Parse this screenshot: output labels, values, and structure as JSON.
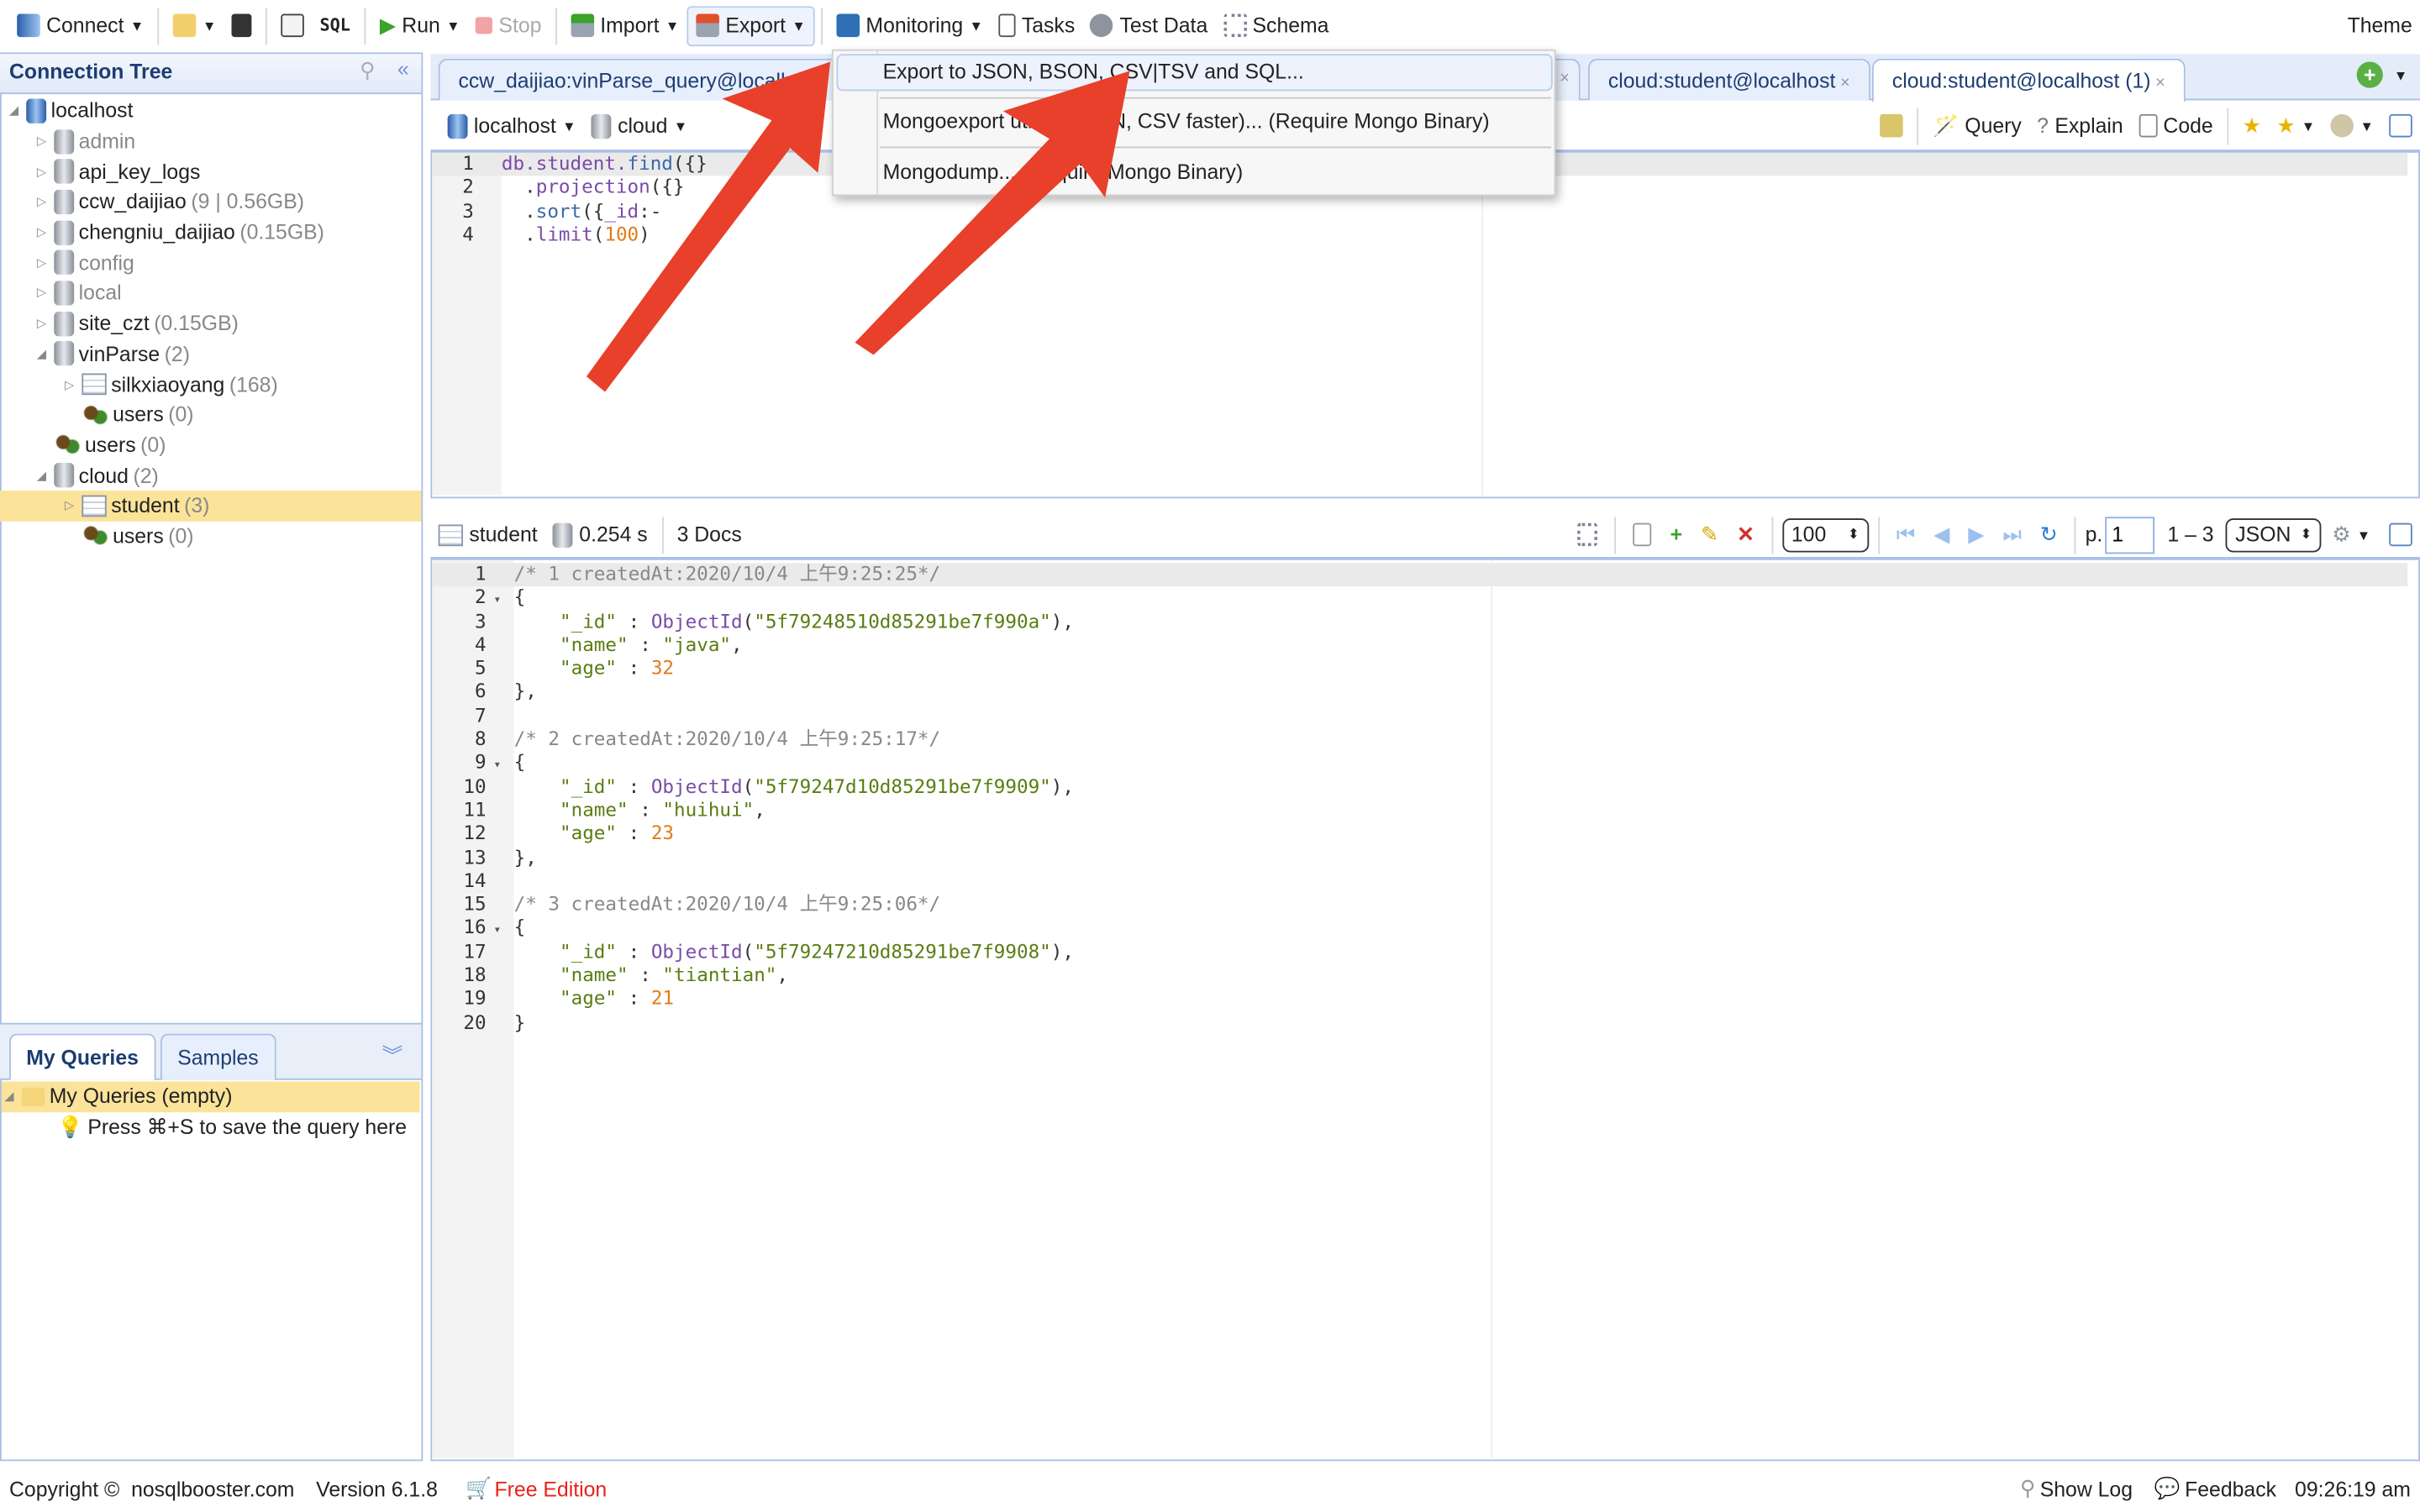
{
  "toolbar": {
    "connect": "Connect",
    "sql": "SQL",
    "run": "Run",
    "stop": "Stop",
    "import": "Import",
    "export": "Export",
    "monitoring": "Monitoring",
    "tasks": "Tasks",
    "test_data": "Test Data",
    "schema": "Schema",
    "theme": "Theme"
  },
  "export_menu": {
    "items": [
      "Export to JSON, BSON, CSV|TSV and SQL...",
      "Mongoexport utility (JSON, CSV faster)... (Require Mongo Binary)",
      "Mongodump... (Require Mongo Binary)"
    ]
  },
  "connection_tree": {
    "title": "Connection Tree",
    "items": [
      {
        "label": "localhost",
        "meta": "",
        "level": 0,
        "icon": "server",
        "twisty": "open"
      },
      {
        "label": "admin",
        "meta": "",
        "level": 1,
        "icon": "db",
        "twisty": "closed",
        "dim": true
      },
      {
        "label": "api_key_logs",
        "meta": "",
        "level": 1,
        "icon": "db",
        "twisty": "closed"
      },
      {
        "label": "ccw_daijiao",
        "meta": "(9 | 0.56GB)",
        "level": 1,
        "icon": "db",
        "twisty": "closed"
      },
      {
        "label": "chengniu_daijiao",
        "meta": "(0.15GB)",
        "level": 1,
        "icon": "db",
        "twisty": "closed"
      },
      {
        "label": "config",
        "meta": "",
        "level": 1,
        "icon": "db",
        "twisty": "closed",
        "dim": true
      },
      {
        "label": "local",
        "meta": "",
        "level": 1,
        "icon": "db",
        "twisty": "closed",
        "dim": true
      },
      {
        "label": "site_czt",
        "meta": "(0.15GB)",
        "level": 1,
        "icon": "db",
        "twisty": "closed"
      },
      {
        "label": "vinParse",
        "meta": "(2)",
        "level": 1,
        "icon": "db",
        "twisty": "open"
      },
      {
        "label": "silkxiaoyang",
        "meta": "(168)",
        "level": 2,
        "icon": "collection",
        "twisty": "closed"
      },
      {
        "label": "users",
        "meta": "(0)",
        "level": 2,
        "icon": "users",
        "twisty": ""
      },
      {
        "label": "users",
        "meta": "(0)",
        "level": 1,
        "icon": "users",
        "twisty": ""
      },
      {
        "label": "cloud",
        "meta": "(2)",
        "level": 1,
        "icon": "db",
        "twisty": "open"
      },
      {
        "label": "student",
        "meta": "(3)",
        "level": 2,
        "icon": "collection",
        "twisty": "closed",
        "selected": true
      },
      {
        "label": "users",
        "meta": "(0)",
        "level": 2,
        "icon": "users",
        "twisty": ""
      }
    ]
  },
  "query_panel": {
    "tabs": [
      "My Queries",
      "Samples"
    ],
    "items": [
      {
        "label": "My Queries (empty)"
      },
      {
        "label": "Press ⌘+S to save the query here"
      }
    ]
  },
  "tabs": [
    {
      "label": "ccw_daijiao:vinParse_query@localh"
    },
    {
      "label": "cloud:student@localhost"
    },
    {
      "label": "cloud:student@localhost (1)",
      "active": true
    }
  ],
  "editor_toolbar": {
    "connection": "localhost",
    "database": "cloud",
    "query": "Query",
    "explain": "Explain",
    "code": "Code"
  },
  "editor": {
    "lines": [
      [
        {
          "t": "db.student.",
          "c": "k"
        },
        {
          "t": "find",
          "c": "f"
        },
        {
          "t": "({}",
          "c": "p"
        }
      ],
      [
        {
          "t": "  .",
          "c": "p"
        },
        {
          "t": "projection",
          "c": "k"
        },
        {
          "t": "({}",
          "c": "p"
        }
      ],
      [
        {
          "t": "  .",
          "c": "p"
        },
        {
          "t": "sort",
          "c": "f"
        },
        {
          "t": "({",
          "c": "p"
        },
        {
          "t": "_id",
          "c": "k"
        },
        {
          "t": ":-",
          "c": "p"
        }
      ],
      [
        {
          "t": "  .",
          "c": "p"
        },
        {
          "t": "limit",
          "c": "k"
        },
        {
          "t": "(",
          "c": "p"
        },
        {
          "t": "100",
          "c": "n"
        },
        {
          "t": ")",
          "c": "p"
        }
      ]
    ]
  },
  "results_toolbar": {
    "collection": "student",
    "time": "0.254 s",
    "docs": "3 Docs",
    "page_size": "100",
    "page_label": "p.",
    "page": "1",
    "range": "1 – 3",
    "format": "JSON"
  },
  "results": {
    "lines": [
      [
        {
          "t": "/* 1 createdAt:2020/10/4 上午9:25:25*/",
          "c": "c"
        }
      ],
      [
        {
          "t": "{",
          "c": "p"
        }
      ],
      [
        {
          "t": "    \"_id\"",
          "c": "s"
        },
        {
          "t": " : ",
          "c": "p"
        },
        {
          "t": "ObjectId",
          "c": "o"
        },
        {
          "t": "(",
          "c": "p"
        },
        {
          "t": "\"5f79248510d85291be7f990a\"",
          "c": "s"
        },
        {
          "t": "),",
          "c": "p"
        }
      ],
      [
        {
          "t": "    \"name\"",
          "c": "s"
        },
        {
          "t": " : ",
          "c": "p"
        },
        {
          "t": "\"java\"",
          "c": "s"
        },
        {
          "t": ",",
          "c": "p"
        }
      ],
      [
        {
          "t": "    \"age\"",
          "c": "s"
        },
        {
          "t": " : ",
          "c": "p"
        },
        {
          "t": "32",
          "c": "n"
        }
      ],
      [
        {
          "t": "},",
          "c": "p"
        }
      ],
      [],
      [
        {
          "t": "/* 2 createdAt:2020/10/4 上午9:25:17*/",
          "c": "c"
        }
      ],
      [
        {
          "t": "{",
          "c": "p"
        }
      ],
      [
        {
          "t": "    \"_id\"",
          "c": "s"
        },
        {
          "t": " : ",
          "c": "p"
        },
        {
          "t": "ObjectId",
          "c": "o"
        },
        {
          "t": "(",
          "c": "p"
        },
        {
          "t": "\"5f79247d10d85291be7f9909\"",
          "c": "s"
        },
        {
          "t": "),",
          "c": "p"
        }
      ],
      [
        {
          "t": "    \"name\"",
          "c": "s"
        },
        {
          "t": " : ",
          "c": "p"
        },
        {
          "t": "\"huihui\"",
          "c": "s"
        },
        {
          "t": ",",
          "c": "p"
        }
      ],
      [
        {
          "t": "    \"age\"",
          "c": "s"
        },
        {
          "t": " : ",
          "c": "p"
        },
        {
          "t": "23",
          "c": "n"
        }
      ],
      [
        {
          "t": "},",
          "c": "p"
        }
      ],
      [],
      [
        {
          "t": "/* 3 createdAt:2020/10/4 上午9:25:06*/",
          "c": "c"
        }
      ],
      [
        {
          "t": "{",
          "c": "p"
        }
      ],
      [
        {
          "t": "    \"_id\"",
          "c": "s"
        },
        {
          "t": " : ",
          "c": "p"
        },
        {
          "t": "ObjectId",
          "c": "o"
        },
        {
          "t": "(",
          "c": "p"
        },
        {
          "t": "\"5f79247210d85291be7f9908\"",
          "c": "s"
        },
        {
          "t": "),",
          "c": "p"
        }
      ],
      [
        {
          "t": "    \"name\"",
          "c": "s"
        },
        {
          "t": " : ",
          "c": "p"
        },
        {
          "t": "\"tiantian\"",
          "c": "s"
        },
        {
          "t": ",",
          "c": "p"
        }
      ],
      [
        {
          "t": "    \"age\"",
          "c": "s"
        },
        {
          "t": " : ",
          "c": "p"
        },
        {
          "t": "21",
          "c": "n"
        }
      ],
      [
        {
          "t": "}",
          "c": "p"
        }
      ]
    ],
    "fold_lines": [
      2,
      9,
      16
    ]
  },
  "status": {
    "copyright": "Copyright ©  nosqlbooster.com",
    "version": "Version 6.1.8",
    "edition": "Free Edition",
    "show_log": "Show Log",
    "feedback": "Feedback",
    "time": "09:26:19 am"
  },
  "colors": {
    "accent": "#a9bfe6",
    "selection": "#fbe39a",
    "edition": "#e8231b",
    "arrow": "#e8402a"
  }
}
